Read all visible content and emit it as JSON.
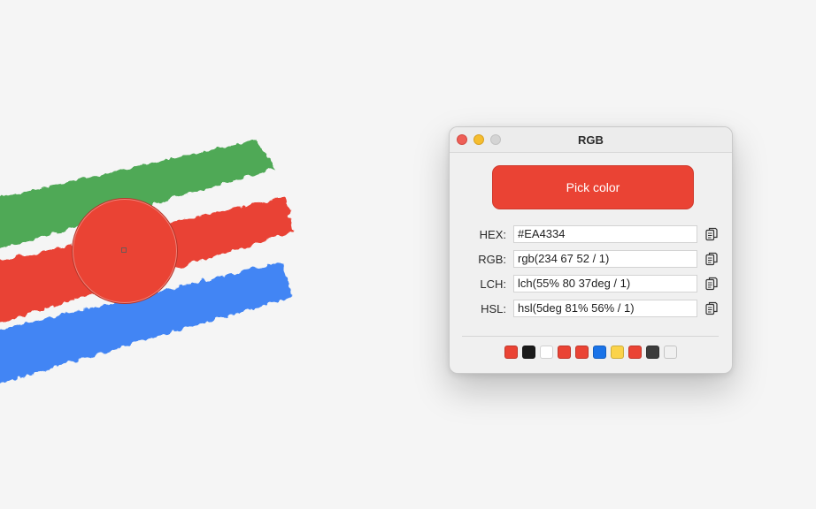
{
  "window": {
    "title": "RGB",
    "pick_button_label": "Pick color",
    "pick_button_color": "#EA4334"
  },
  "color_formats": [
    {
      "label": "HEX:",
      "value": "#EA4334"
    },
    {
      "label": "RGB:",
      "value": "rgb(234 67 52 / 1)"
    },
    {
      "label": "LCH:",
      "value": "lch(55% 80 37deg / 1)"
    },
    {
      "label": "HSL:",
      "value": "hsl(5deg 81% 56% / 1)"
    }
  ],
  "icons": {
    "copy": "copy-icon",
    "close": "close-icon",
    "minimize": "minimize-icon",
    "zoom": "zoom-icon"
  },
  "history_swatches": [
    "#EA4334",
    "#1a1a1a",
    "#ffffff",
    "#EA4334",
    "#EA4334",
    "#1a73e8",
    "#fbd34a",
    "#EA4334",
    "#3c3c3c",
    "#f0f0f0"
  ],
  "canvas": {
    "stroke_colors": {
      "green": "#4fa956",
      "red": "#e94234",
      "blue": "#4285f4"
    },
    "magnifier_color": "#EA4334"
  }
}
